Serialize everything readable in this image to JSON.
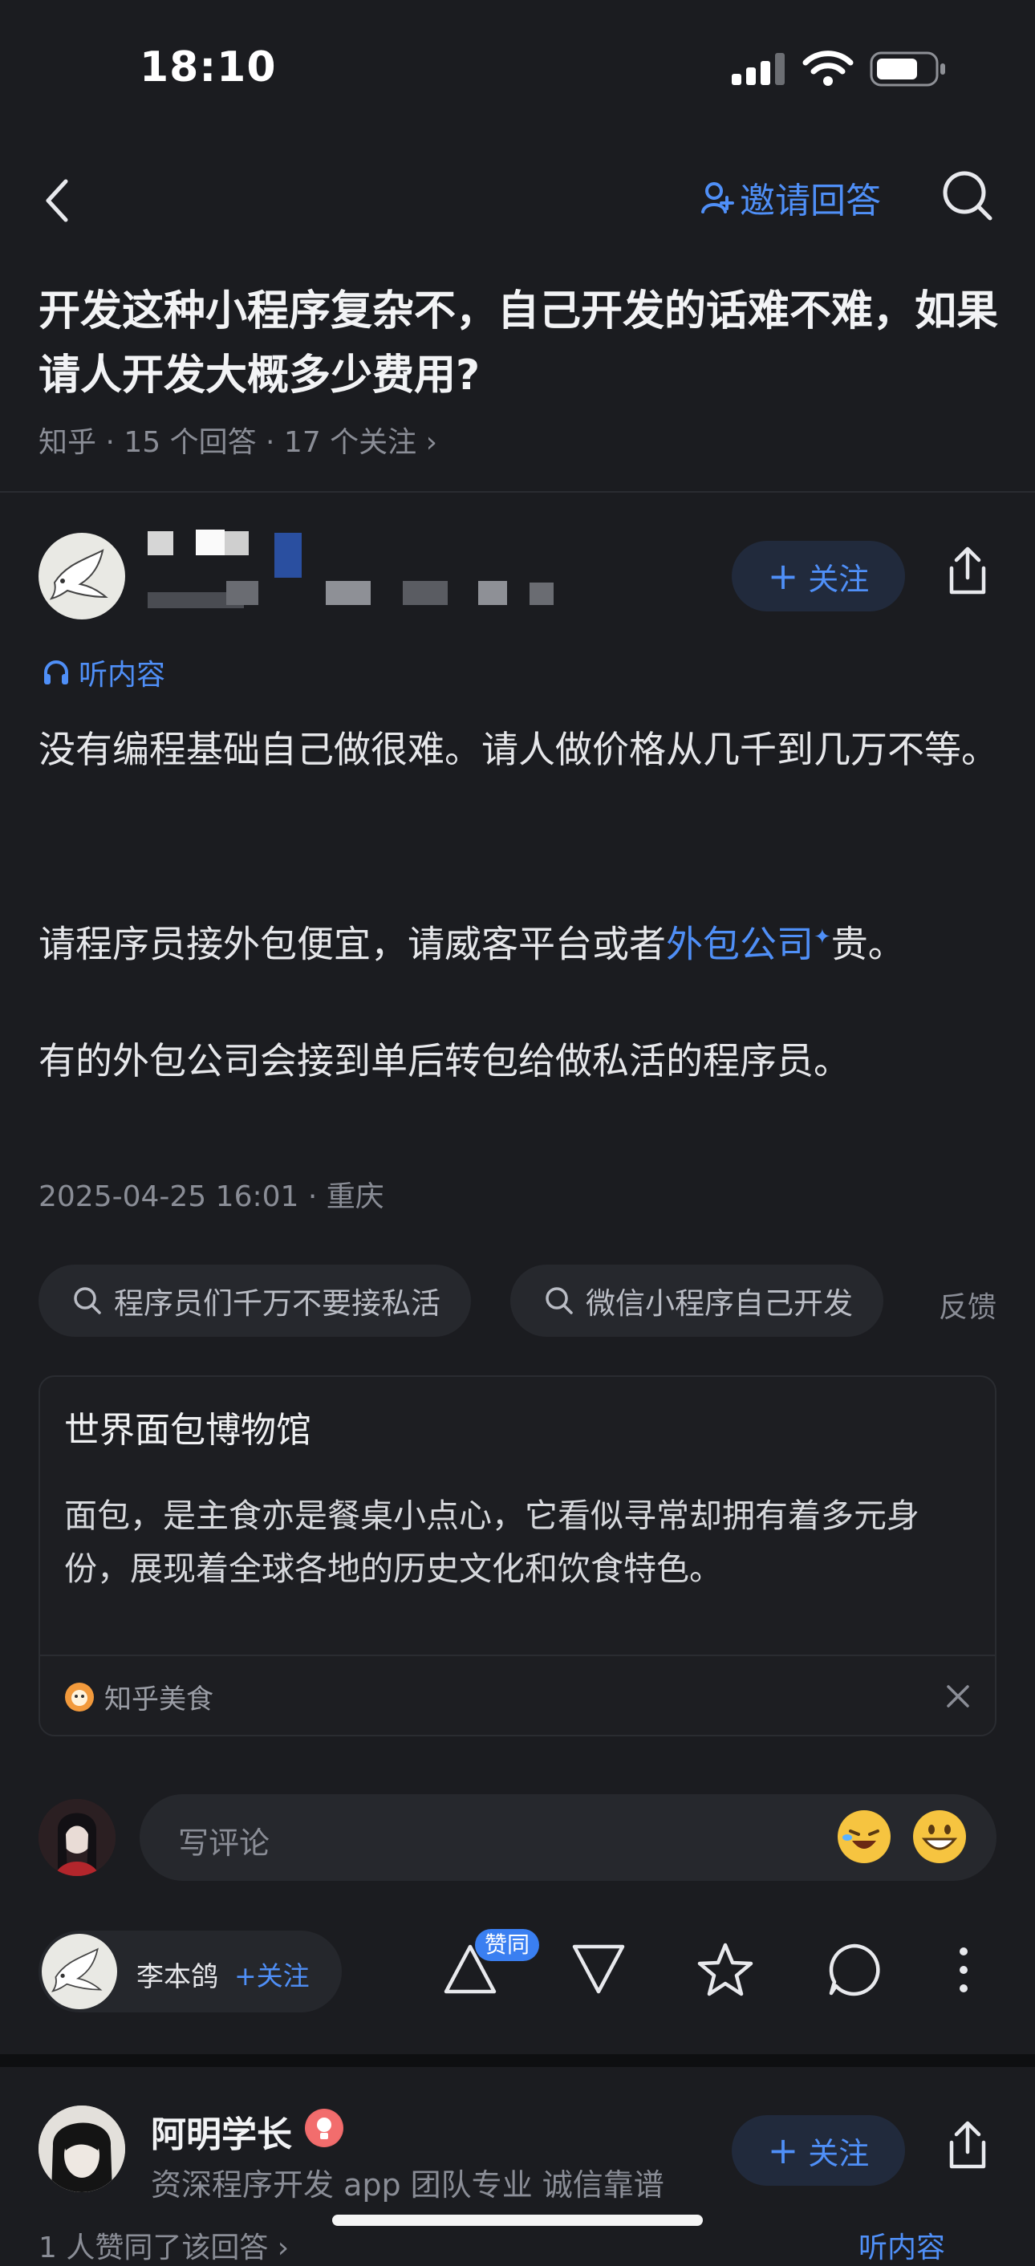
{
  "status": {
    "time": "18:10"
  },
  "nav": {
    "invite_label": "邀请回答"
  },
  "question": {
    "title": "开发这种小程序复杂不，自己开发的话难不难，如果请人开发大概多少费用?",
    "meta": "知乎 · 15 个回答 · 17 个关注 ›"
  },
  "answer": {
    "follow_label": "关注",
    "listen_label": "听内容",
    "para1": "没有编程基础自己做很难。请人做价格从几千到几万不等。",
    "para2_prefix": "请程序员接外包便宜，请威客平台或者",
    "para2_link": "外包公司",
    "para2_suffix": "贵。",
    "para3": "有的外包公司会接到单后转包给做私活的程序员。",
    "date": "2025-04-25 16:01 · 重庆"
  },
  "related": {
    "chips": [
      "程序员们千万不要接私活",
      "微信小程序自己开发"
    ],
    "feedback": "反馈"
  },
  "ad": {
    "title": "世界面包博物馆",
    "body": "面包，是主食亦是餐桌小点心，它看似寻常却拥有着多元身份，展现着全球各地的历史文化和饮食特色。",
    "source": "知乎美食"
  },
  "comment": {
    "placeholder": "写评论"
  },
  "bottom_bar": {
    "author_name": "李本鸽",
    "follow_label": "+关注",
    "agree_badge": "赞同"
  },
  "next_answer": {
    "author_name": "阿明学长",
    "bio": "资深程序开发 app 团队专业 诚信靠谱",
    "follow_label": "关注",
    "snippet": "1 人赞同了该回答 ›",
    "listen_label": "听内容"
  }
}
